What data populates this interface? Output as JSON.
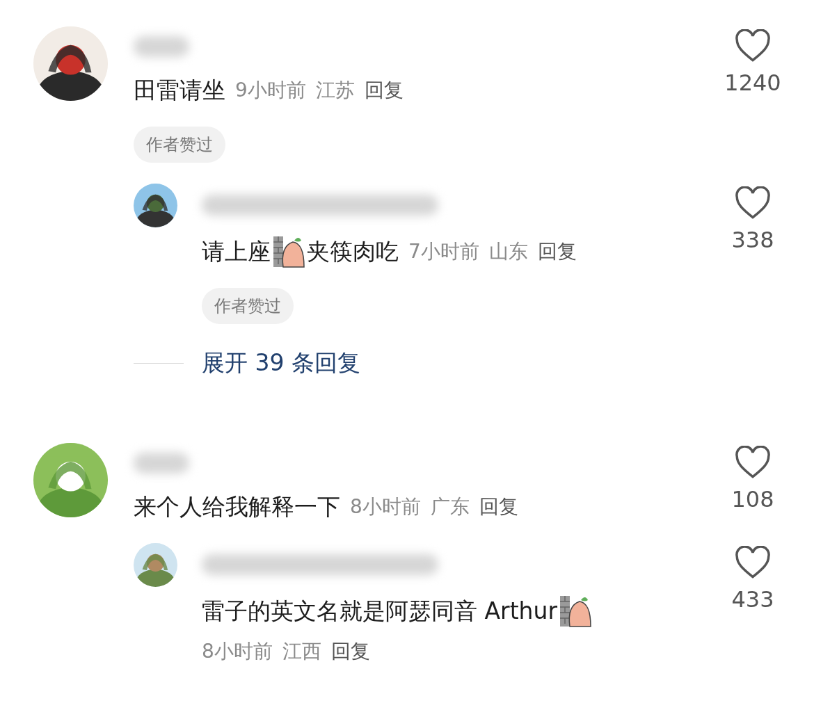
{
  "comments": [
    {
      "avatar": {
        "kind": "picture"
      },
      "parts": [
        {
          "kind": "text",
          "text": "田雷请坐"
        }
      ],
      "time": "9小时前",
      "region": "江苏",
      "reply": "回复",
      "badge": "作者赞过",
      "likes": "1240",
      "replies": [
        {
          "avatar": {
            "kind": "picture"
          },
          "parts": [
            {
              "kind": "text",
              "text": "请上座"
            },
            {
              "kind": "sticker"
            },
            {
              "kind": "text",
              "text": "夹筷肉吃"
            }
          ],
          "time": "7小时前",
          "region": "山东",
          "reply": "回复",
          "badge": "作者赞过",
          "likes": "338"
        }
      ],
      "expand": "展开 39 条回复"
    },
    {
      "avatar": {
        "kind": "picture"
      },
      "parts": [
        {
          "kind": "text",
          "text": "来个人给我解释一下"
        }
      ],
      "time": "8小时前",
      "region": "广东",
      "reply": "回复",
      "likes": "108",
      "replies": [
        {
          "avatar": {
            "kind": "picture"
          },
          "parts": [
            {
              "kind": "text",
              "text": "雷子的英文名就是阿瑟同音 Arthur"
            },
            {
              "kind": "sticker"
            }
          ],
          "meta_below": true,
          "time": "8小时前",
          "region": "江西",
          "reply": "回复",
          "likes": "433"
        }
      ]
    }
  ]
}
